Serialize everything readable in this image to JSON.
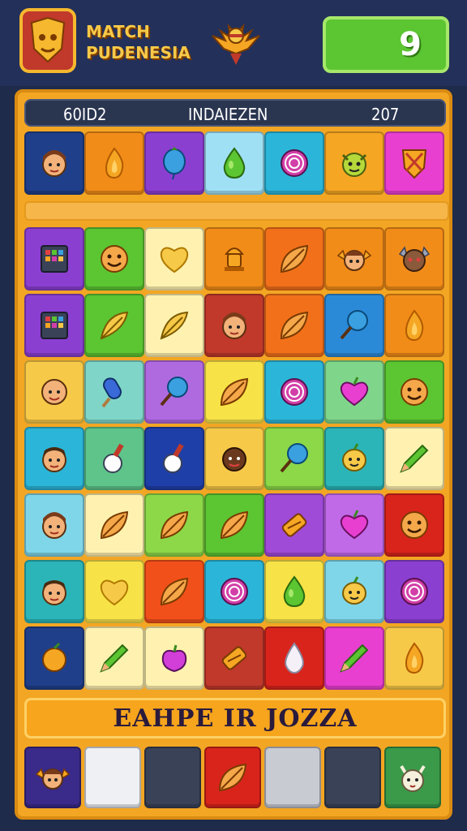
{
  "header": {
    "logo_line1": "MATCH",
    "logo_line2": "PUDENESIA",
    "score": "9"
  },
  "stats": {
    "left": "60ID2",
    "middle": "INDAIEZEN",
    "right": "207"
  },
  "banner": {
    "text": "EAHPE IR JOZZA"
  },
  "colors": {
    "background": "#1f2b4a",
    "board": "#f3a623",
    "score_box": "#5cc532",
    "accent": "#f7c948"
  },
  "top_row": [
    {
      "icon": "girl-face-icon",
      "color": "#1f3f8a"
    },
    {
      "icon": "flame-icon",
      "color": "#f28c18"
    },
    {
      "icon": "blue-balloon-icon",
      "color": "#8b3fd1"
    },
    {
      "icon": "green-drop-icon",
      "color": "#9fe0f5"
    },
    {
      "icon": "swirl-candy-icon",
      "color": "#2bb5d8"
    },
    {
      "icon": "yellow-monster-icon",
      "color": "#f5a623"
    },
    {
      "icon": "crossed-swords-shield-icon",
      "color": "#e83fd1"
    }
  ],
  "grid": [
    [
      "tablet-icon",
      "smiley-face-icon",
      "heart-icon",
      "lamp-icon",
      "leaf-icon",
      "winged-face-icon",
      "armored-face-icon"
    ],
    [
      "tablet-icon",
      "feather-icon",
      "feather-icon",
      "girl-face-icon",
      "leaf-icon",
      "lollipop-icon",
      "flame-icon"
    ],
    [
      "bald-face-icon",
      "popsicle-icon",
      "lollipop-icon",
      "leaf-icon",
      "swirl-candy-icon",
      "heart-fruit-icon",
      "smiley-face-icon"
    ],
    [
      "boy-face-icon",
      "potion-icon",
      "potion-icon",
      "brown-face-icon",
      "lollipop-icon",
      "lemon-face-icon",
      "pencil-icon"
    ],
    [
      "girl-face-icon",
      "leaf-icon",
      "leaf-icon",
      "leaf-icon",
      "candy-bar-icon",
      "heart-fruit-icon",
      "smiley-face-icon"
    ],
    [
      "boy-face-icon",
      "heart-icon",
      "leaf-icon",
      "swirl-candy-icon",
      "green-drop-icon",
      "lemon-face-icon",
      "swirl-candy-icon"
    ],
    [
      "orange-fruit-icon",
      "pencil-icon",
      "apple-icon",
      "candy-bar-icon",
      "cream-drop-icon",
      "pencil-icon",
      "flame-icon"
    ]
  ],
  "tray": [
    {
      "icon": "winged-face-icon",
      "color": "#3a2a8a"
    },
    {
      "icon": "empty-slot",
      "color": "#eef0f4"
    },
    {
      "icon": "empty-slot",
      "color": "#3a4258"
    },
    {
      "icon": "leaf-icon",
      "color": "#d9241c"
    },
    {
      "icon": "empty-slot",
      "color": "#c9cbd3"
    },
    {
      "icon": "empty-slot",
      "color": "#3a4258"
    },
    {
      "icon": "goat-face-icon",
      "color": "#3a9a4a"
    }
  ]
}
